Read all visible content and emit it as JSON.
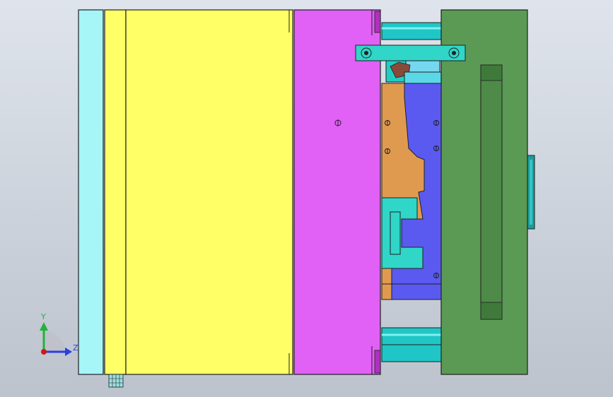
{
  "viewport": {
    "background_top": "#dfe4ec",
    "background_bottom": "#bcc3cd"
  },
  "colors": {
    "clamp_plate": "#a6f5f7",
    "yellow_plate": "#ffff66",
    "magenta_plate": "#e160f5",
    "green_plate": "#5b9a54",
    "guide_pin": "#20c6c6",
    "blue_core": "#5a5af0",
    "orange_core": "#e09a50",
    "teal_insert": "#30d6c8",
    "edge": "#202020"
  },
  "triad": {
    "y_label": "Y",
    "z_label": "Z",
    "y_color": "#22b33a",
    "z_color": "#2a3fe0",
    "origin_color": "#d01818"
  }
}
